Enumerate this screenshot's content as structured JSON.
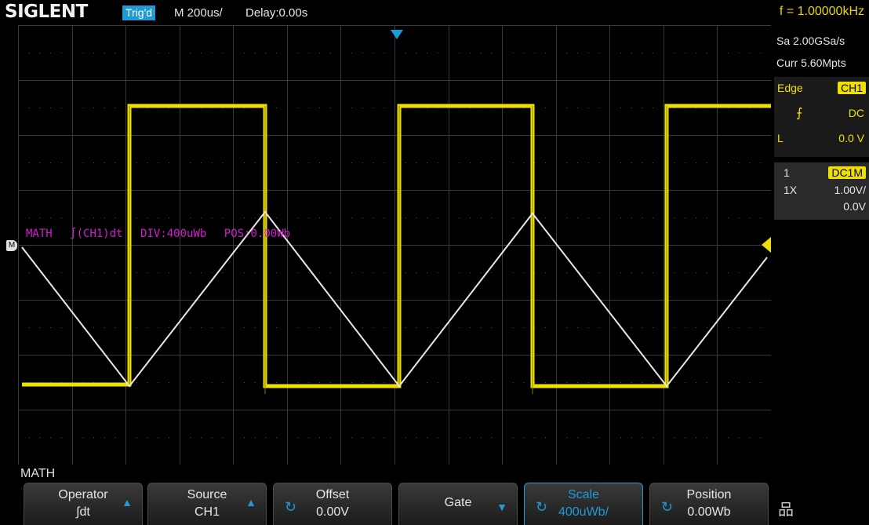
{
  "header": {
    "brand": "SIGLENT",
    "trigger_state": "Trig'd",
    "timebase": "M 200us/",
    "delay": "Delay:0.00s",
    "frequency": "f = 1.00000kHz"
  },
  "right_panel": {
    "sample_rate": "Sa 2.00GSa/s",
    "memory_depth": "Curr 5.60Mpts",
    "trigger": {
      "type": "Edge",
      "source": "CH1",
      "slope_icon": "rising-edge-icon",
      "coupling": "DC",
      "level_label": "L",
      "level": "0.0 V"
    },
    "channel": {
      "number": "1",
      "coupling_impedance": "DC1M",
      "probe": "1X",
      "scale": "1.00V/",
      "offset": "0.0V"
    }
  },
  "math_info": {
    "name": "MATH",
    "expression": "∫(CH1)dt",
    "div": "DIV:400uWb",
    "pos": "POS:0.00Wb",
    "marker": "M"
  },
  "menu": {
    "title": "MATH",
    "softkeys": [
      {
        "label": "Operator",
        "value": "∫dt",
        "icon": "up-arrow-icon"
      },
      {
        "label": "Source",
        "value": "CH1",
        "icon": "up-arrow-icon"
      },
      {
        "label": "Offset",
        "value": "0.00V",
        "icon": "knob-icon"
      },
      {
        "label": "Gate",
        "value": "",
        "icon": "down-arrow-icon"
      },
      {
        "label": "Scale",
        "value": "400uWb/",
        "icon": "knob-icon"
      },
      {
        "label": "Position",
        "value": "0.00Wb",
        "icon": "knob-icon"
      }
    ],
    "network_icon": "lan-icon"
  },
  "colors": {
    "ch1": "#f0e000",
    "math": "#e8e8e8",
    "math_label": "#d21bd2",
    "accent": "#1e9bd7"
  },
  "waveform": {
    "frequency_hz": 1000,
    "timebase_s_per_div": 0.0002,
    "ch1_shape": "square",
    "math_shape": "triangle"
  }
}
